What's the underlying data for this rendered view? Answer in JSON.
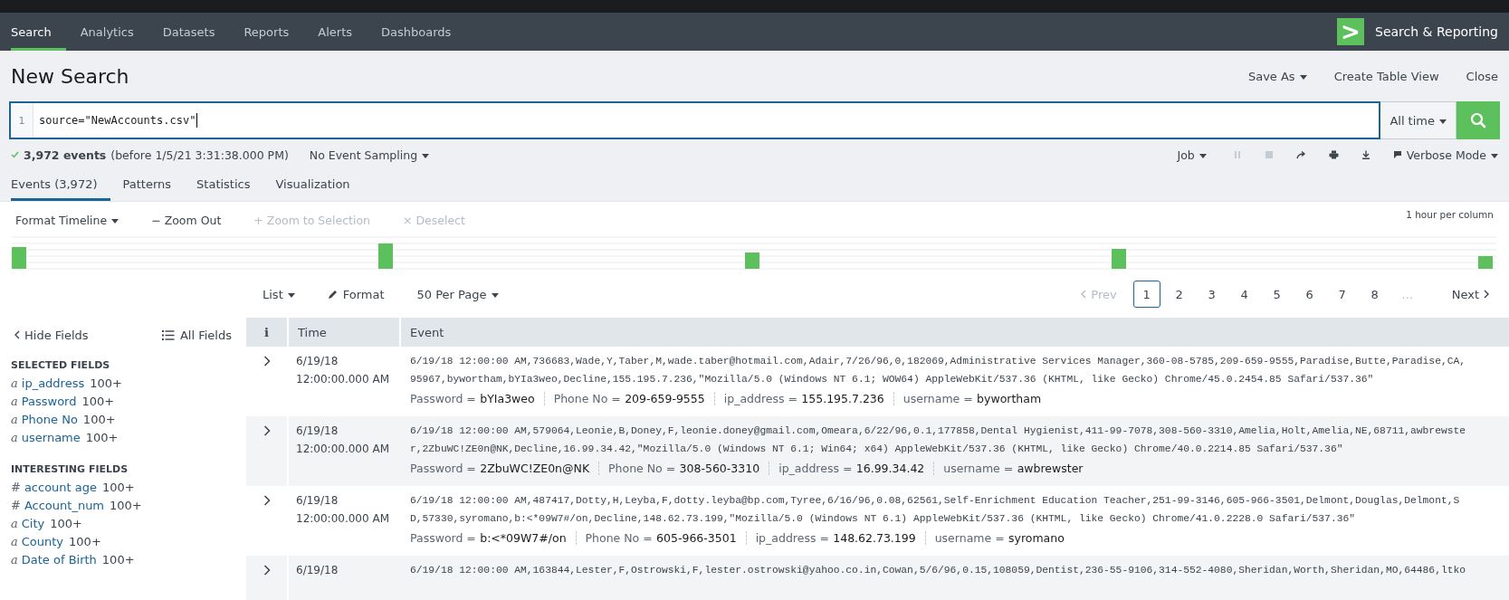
{
  "nav": {
    "tabs": [
      {
        "label": "Search",
        "selected": true
      },
      {
        "label": "Analytics",
        "selected": false
      },
      {
        "label": "Datasets",
        "selected": false
      },
      {
        "label": "Reports",
        "selected": false
      },
      {
        "label": "Alerts",
        "selected": false
      },
      {
        "label": "Dashboards",
        "selected": false
      }
    ],
    "app_logo": ">",
    "app_name": "Search & Reporting"
  },
  "title": "New Search",
  "title_actions": [
    {
      "label": "Save As",
      "dropdown": true
    },
    {
      "label": "Create Table View",
      "dropdown": false
    },
    {
      "label": "Close",
      "dropdown": false
    }
  ],
  "search": {
    "line_number": "1",
    "value": "source=\"NewAccounts.csv\"",
    "time_range": "All time"
  },
  "status": {
    "count": "3,972 events",
    "detail": "(before 1/5/21 3:31:38.000 PM)",
    "sampling": "No Event Sampling",
    "job": "Job",
    "mode": "Verbose Mode"
  },
  "result_tabs": [
    {
      "label": "Events (3,972)",
      "selected": true
    },
    {
      "label": "Patterns",
      "selected": false
    },
    {
      "label": "Statistics",
      "selected": false
    },
    {
      "label": "Visualization",
      "selected": false
    }
  ],
  "timeline": {
    "actions": [
      {
        "label": "Format Timeline",
        "dropdown": true,
        "disabled": false
      },
      {
        "symbol": "−",
        "label": "Zoom Out",
        "dropdown": false,
        "disabled": false
      },
      {
        "symbol": "+",
        "label": "Zoom to Selection",
        "dropdown": false,
        "disabled": true
      },
      {
        "symbol": "×",
        "label": "Deselect",
        "dropdown": false,
        "disabled": true
      }
    ],
    "scale": "1 hour per column"
  },
  "list_controls": {
    "view": "List",
    "format": "Format",
    "per_page": "50 Per Page"
  },
  "pagination": {
    "prev": "Prev",
    "next": "Next",
    "ellipsis": "…",
    "pages": [
      {
        "label": "1",
        "selected": true
      },
      {
        "label": "2",
        "selected": false
      },
      {
        "label": "3",
        "selected": false
      },
      {
        "label": "4",
        "selected": false
      },
      {
        "label": "5",
        "selected": false
      },
      {
        "label": "6",
        "selected": false
      },
      {
        "label": "7",
        "selected": false
      },
      {
        "label": "8",
        "selected": false
      }
    ]
  },
  "sidebar": {
    "hide": "Hide Fields",
    "all": "All Fields",
    "groups": [
      {
        "heading": "SELECTED FIELDS",
        "fields": [
          {
            "type": "a",
            "name": "ip_address",
            "count": "100+"
          },
          {
            "type": "a",
            "name": "Password",
            "count": "100+"
          },
          {
            "type": "a",
            "name": "Phone No",
            "count": "100+"
          },
          {
            "type": "a",
            "name": "username",
            "count": "100+"
          }
        ]
      },
      {
        "heading": "INTERESTING FIELDS",
        "fields": [
          {
            "type": "#",
            "name": "account age",
            "count": "100+"
          },
          {
            "type": "#",
            "name": "Account_num",
            "count": "100+"
          },
          {
            "type": "a",
            "name": "City",
            "count": "100+"
          },
          {
            "type": "a",
            "name": "County",
            "count": "100+"
          },
          {
            "type": "a",
            "name": "Date of Birth",
            "count": "100+"
          }
        ]
      }
    ]
  },
  "table": {
    "columns": [
      "i",
      "Time",
      "Event"
    ],
    "rows": [
      {
        "date": "6/19/18",
        "time": "12:00:00.000 AM",
        "lines": [
          "6/19/18 12:00:00 AM,736683,Wade,Y,Taber,M,wade.taber@hotmail.com,Adair,7/26/96,0,182069,Administrative Services Manager,360-08-5785,209-659-9555,Paradise,Butte,Paradise,CA,",
          "95967,bywortham,bYIa3weo,Decline,155.195.7.236,\"Mozilla/5.0 (Windows NT 6.1; WOW64) AppleWebKit/537.36 (KHTML, like Gecko) Chrome/45.0.2454.85 Safari/537.36\""
        ],
        "fields": [
          {
            "key": "Password =",
            "value": "bYIa3weo"
          },
          {
            "key": "Phone No =",
            "value": "209-659-9555"
          },
          {
            "key": "ip_address =",
            "value": "155.195.7.236"
          },
          {
            "key": "username =",
            "value": "bywortham"
          }
        ]
      },
      {
        "date": "6/19/18",
        "time": "12:00:00.000 AM",
        "lines": [
          "6/19/18 12:00:00 AM,579064,Leonie,B,Doney,F,leonie.doney@gmail.com,Omeara,6/22/96,0.1,177858,Dental Hygienist,411-99-7078,308-560-3310,Amelia,Holt,Amelia,NE,68711,awbrewste",
          "r,2ZbuWC!ZE0n@NK,Decline,16.99.34.42,\"Mozilla/5.0 (Windows NT 6.1; Win64; x64) AppleWebKit/537.36 (KHTML, like Gecko) Chrome/40.0.2214.85 Safari/537.36\""
        ],
        "fields": [
          {
            "key": "Password =",
            "value": "2ZbuWC!ZE0n@NK"
          },
          {
            "key": "Phone No =",
            "value": "308-560-3310"
          },
          {
            "key": "ip_address =",
            "value": "16.99.34.42"
          },
          {
            "key": "username =",
            "value": "awbrewster"
          }
        ]
      },
      {
        "date": "6/19/18",
        "time": "12:00:00.000 AM",
        "lines": [
          "6/19/18 12:00:00 AM,487417,Dotty,H,Leyba,F,dotty.leyba@bp.com,Tyree,6/16/96,0.08,62561,Self-Enrichment Education Teacher,251-99-3146,605-966-3501,Delmont,Douglas,Delmont,S",
          "D,57330,syromano,b:<*09W7#/on,Decline,148.62.73.199,\"Mozilla/5.0 (Windows NT 6.1) AppleWebKit/537.36 (KHTML, like Gecko) Chrome/41.0.2228.0 Safari/537.36\""
        ],
        "fields": [
          {
            "key": "Password =",
            "value": "b:<*09W7#/on"
          },
          {
            "key": "Phone No =",
            "value": "605-966-3501"
          },
          {
            "key": "ip_address =",
            "value": "148.62.73.199"
          },
          {
            "key": "username =",
            "value": "syromano"
          }
        ]
      },
      {
        "date": "6/19/18",
        "lines": [
          "6/19/18 12:00:00 AM,163844,Lester,F,Ostrowski,F,lester.ostrowski@yahoo.co.in,Cowan,5/6/96,0.15,108059,Dentist,236-55-9106,314-552-4080,Sheridan,Worth,Sheridan,MO,64486,ltko"
        ]
      }
    ]
  }
}
